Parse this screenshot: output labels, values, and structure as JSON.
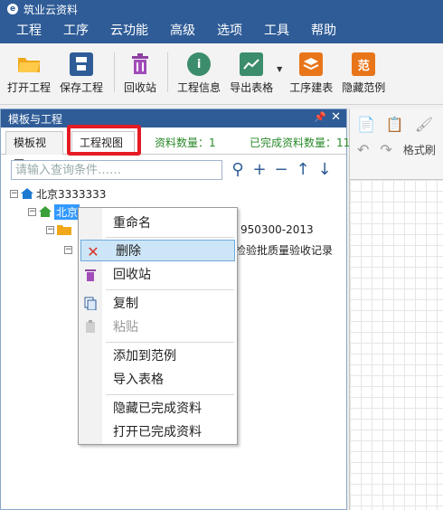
{
  "app": {
    "title": "筑业云资料"
  },
  "menu": [
    "工程",
    "工序",
    "云功能",
    "高级",
    "选项",
    "工具",
    "帮助"
  ],
  "toolbar": {
    "open": "打开工程",
    "save": "保存工程",
    "recycle": "回收站",
    "info": "工程信息",
    "export": "导出表格",
    "build": "工序建表",
    "hide_sample": "隐藏范例",
    "sample_icon_char": "范"
  },
  "panel": {
    "title": "模板与工程",
    "tabs": [
      "模板视图",
      "工程视图"
    ],
    "doc_count": "资料数量：1",
    "done_count": "已完成资料数量：11",
    "search_placeholder": "请输入查询条件……"
  },
  "tree": {
    "root": "北京3333333",
    "child": "北京",
    "std_suffix": "950300-2013",
    "record": "检验批质量验收记录"
  },
  "right": {
    "format_label": "格式刷"
  },
  "context_menu": {
    "rename": "重命名",
    "delete": "删除",
    "recycle": "回收站",
    "copy": "复制",
    "paste": "粘贴",
    "add_sample": "添加到范例",
    "import_table": "导入表格",
    "hide_done": "隐藏已完成资料",
    "open_done": "打开已完成资料"
  },
  "colors": {
    "accent": "#2f5c97",
    "highlight": "#e51b24",
    "count_text": "#2a8a2a"
  }
}
